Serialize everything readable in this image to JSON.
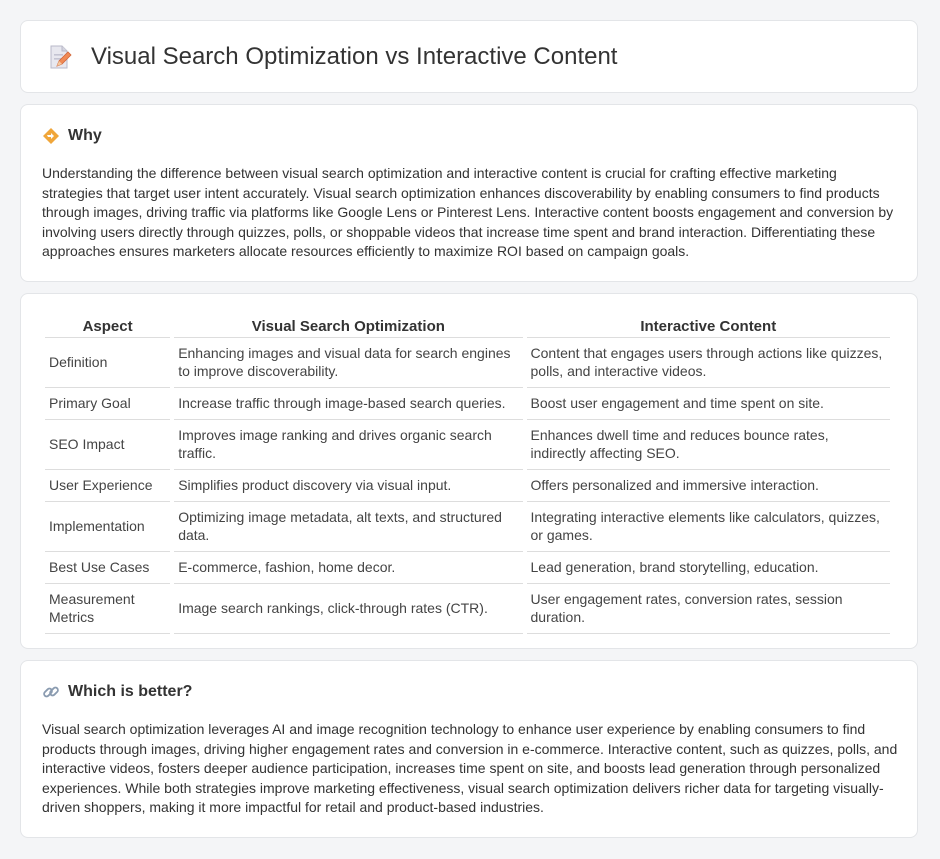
{
  "header": {
    "title": "Visual Search Optimization vs Interactive Content",
    "icon": "document-pen-icon"
  },
  "why": {
    "label": "Why",
    "icon": "diamond-signpost-icon",
    "body": "Understanding the difference between visual search optimization and interactive content is crucial for crafting effective marketing strategies that target user intent accurately. Visual search optimization enhances discoverability by enabling consumers to find products through images, driving traffic via platforms like Google Lens or Pinterest Lens. Interactive content boosts engagement and conversion by involving users directly through quizzes, polls, or shoppable videos that increase time spent and brand interaction. Differentiating these approaches ensures marketers allocate resources efficiently to maximize ROI based on campaign goals."
  },
  "table": {
    "headers": [
      "Aspect",
      "Visual Search Optimization",
      "Interactive Content"
    ],
    "rows": [
      [
        "Definition",
        "Enhancing images and visual data for search engines to improve discoverability.",
        "Content that engages users through actions like quizzes, polls, and interactive videos."
      ],
      [
        "Primary Goal",
        "Increase traffic through image-based search queries.",
        "Boost user engagement and time spent on site."
      ],
      [
        "SEO Impact",
        "Improves image ranking and drives organic search traffic.",
        "Enhances dwell time and reduces bounce rates, indirectly affecting SEO."
      ],
      [
        "User Experience",
        "Simplifies product discovery via visual input.",
        "Offers personalized and immersive interaction."
      ],
      [
        "Implementation",
        "Optimizing image metadata, alt texts, and structured data.",
        "Integrating interactive elements like calculators, quizzes, or games."
      ],
      [
        "Best Use Cases",
        "E-commerce, fashion, home decor.",
        "Lead generation, brand storytelling, education."
      ],
      [
        "Measurement Metrics",
        "Image search rankings, click-through rates (CTR).",
        "User engagement rates, conversion rates, session duration."
      ]
    ]
  },
  "better": {
    "label": "Which is better?",
    "icon": "link-icon",
    "body": "Visual search optimization leverages AI and image recognition technology to enhance user experience by enabling consumers to find products through images, driving higher engagement rates and conversion in e-commerce. Interactive content, such as quizzes, polls, and interactive videos, fosters deeper audience participation, increases time spent on site, and boosts lead generation through personalized experiences. While both strategies improve marketing effectiveness, visual search optimization delivers richer data for targeting visually-driven shoppers, making it more impactful for retail and product-based industries."
  },
  "colors": {
    "background": "#f4f5f7",
    "card": "#ffffff",
    "accent": "#f0a63a"
  }
}
